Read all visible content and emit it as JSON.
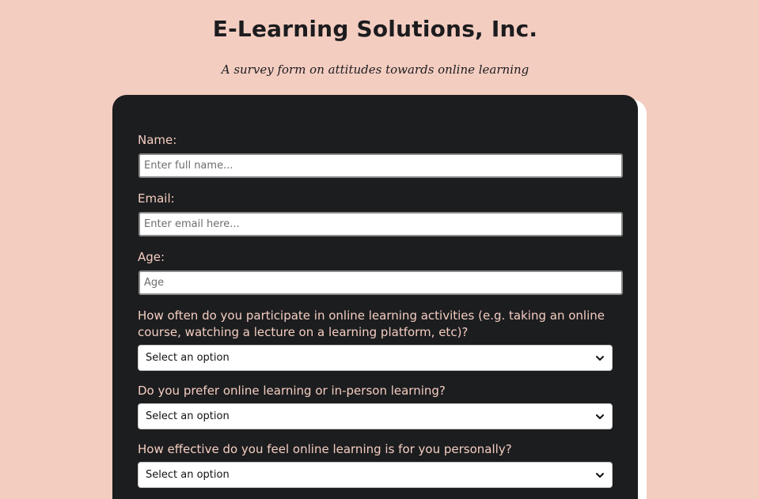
{
  "header": {
    "title": "E-Learning Solutions, Inc.",
    "subtitle": "A survey form on attitudes towards online learning"
  },
  "form": {
    "name": {
      "label": "Name:",
      "placeholder": "Enter full name...",
      "value": ""
    },
    "email": {
      "label": "Email:",
      "placeholder": "Enter email here...",
      "value": ""
    },
    "age": {
      "label": "Age:",
      "placeholder": "Age",
      "value": ""
    },
    "q1": {
      "label": "How often do you participate in online learning activities (e.g. taking an online course, watching a lecture on a learning platform, etc)?",
      "selected": "Select an option"
    },
    "q2": {
      "label": "Do you prefer online learning or in-person learning?",
      "selected": "Select an option"
    },
    "q3": {
      "label": "How effective do you feel online learning is for you personally?",
      "selected": "Select an option"
    }
  },
  "icons": {
    "select_arrow": "chevron-down-icon"
  },
  "colors": {
    "page_background": "#f4cdc1",
    "card_background": "#1c1d1f",
    "label_text": "#f4cdc1",
    "title_text": "#1c1c1e"
  }
}
